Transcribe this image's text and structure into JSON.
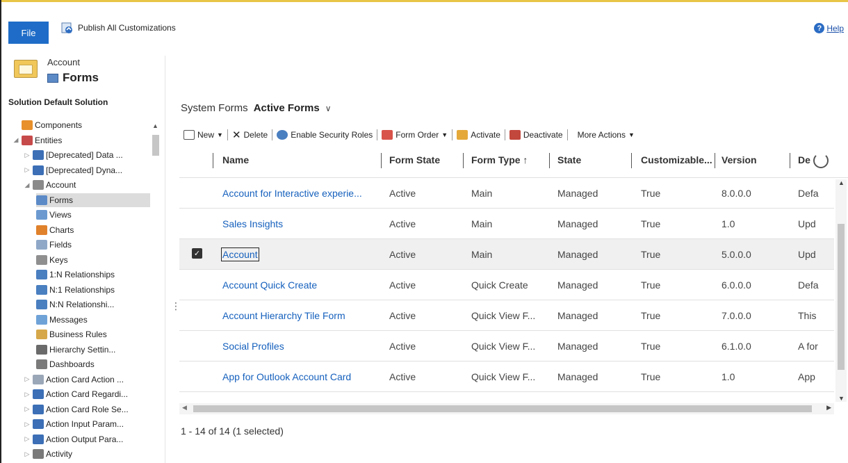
{
  "ribbon": {
    "file_label": "File",
    "publish_label": "Publish All Customizations",
    "help_label": "Help"
  },
  "sidebar": {
    "entity_name": "Account",
    "section_title": "Forms",
    "solution_label": "Solution Default Solution",
    "tree": [
      {
        "label": "Components",
        "depth": 0,
        "twisty": "",
        "icon": "components-icon",
        "color": "#e8902c"
      },
      {
        "label": "Entities",
        "depth": 0,
        "twisty": "◢",
        "icon": "entities-icon",
        "color": "#c74a4a"
      },
      {
        "label": "[Deprecated] Data ...",
        "depth": 1,
        "twisty": "▷",
        "icon": "entity-icon",
        "color": "#3c6fb6"
      },
      {
        "label": "[Deprecated] Dyna...",
        "depth": 1,
        "twisty": "▷",
        "icon": "entity-icon",
        "color": "#3c6fb6"
      },
      {
        "label": "Account",
        "depth": 1,
        "twisty": "◢",
        "icon": "account-icon",
        "color": "#8a8a8a"
      },
      {
        "label": "Forms",
        "depth": 2,
        "twisty": "",
        "icon": "forms-icon",
        "color": "#5c8ac7",
        "selected": true
      },
      {
        "label": "Views",
        "depth": 2,
        "twisty": "",
        "icon": "views-icon",
        "color": "#6c9ad0"
      },
      {
        "label": "Charts",
        "depth": 2,
        "twisty": "",
        "icon": "charts-icon",
        "color": "#e0812c"
      },
      {
        "label": "Fields",
        "depth": 2,
        "twisty": "",
        "icon": "fields-icon",
        "color": "#8fa8c8"
      },
      {
        "label": "Keys",
        "depth": 2,
        "twisty": "",
        "icon": "keys-icon",
        "color": "#8f8f8f"
      },
      {
        "label": "1:N Relationships",
        "depth": 2,
        "twisty": "",
        "icon": "relationship-icon",
        "color": "#4a7fc0"
      },
      {
        "label": "N:1 Relationships",
        "depth": 2,
        "twisty": "",
        "icon": "relationship-icon",
        "color": "#4a7fc0"
      },
      {
        "label": "N:N Relationshi...",
        "depth": 2,
        "twisty": "",
        "icon": "relationship-icon",
        "color": "#4a7fc0"
      },
      {
        "label": "Messages",
        "depth": 2,
        "twisty": "",
        "icon": "messages-icon",
        "color": "#6fa3d8"
      },
      {
        "label": "Business Rules",
        "depth": 2,
        "twisty": "",
        "icon": "business-rules-icon",
        "color": "#d6a84a"
      },
      {
        "label": "Hierarchy Settin...",
        "depth": 2,
        "twisty": "",
        "icon": "hierarchy-icon",
        "color": "#6a6a6a"
      },
      {
        "label": "Dashboards",
        "depth": 2,
        "twisty": "",
        "icon": "dashboards-icon",
        "color": "#7a7a7a"
      },
      {
        "label": "Action Card Action ...",
        "depth": 1,
        "twisty": "▷",
        "icon": "action-card-icon",
        "color": "#9aa7b8"
      },
      {
        "label": "Action Card Regardi...",
        "depth": 1,
        "twisty": "▷",
        "icon": "entity-icon",
        "color": "#3c6fb6"
      },
      {
        "label": "Action Card Role Se...",
        "depth": 1,
        "twisty": "▷",
        "icon": "entity-icon",
        "color": "#3c6fb6"
      },
      {
        "label": "Action Input Param...",
        "depth": 1,
        "twisty": "▷",
        "icon": "entity-icon",
        "color": "#3c6fb6"
      },
      {
        "label": "Action Output Para...",
        "depth": 1,
        "twisty": "▷",
        "icon": "entity-icon",
        "color": "#3c6fb6"
      },
      {
        "label": "Activity",
        "depth": 1,
        "twisty": "▷",
        "icon": "activity-icon",
        "color": "#7a7a7a"
      }
    ]
  },
  "main": {
    "title_prefix": "System Forms",
    "title_view": "Active Forms",
    "title_chevron": "∨",
    "toolbar": {
      "new_label": "New",
      "delete_label": "Delete",
      "security_label": "Enable Security Roles",
      "form_order_label": "Form Order",
      "activate_label": "Activate",
      "deactivate_label": "Deactivate",
      "more_label": "More Actions"
    },
    "columns": [
      "Name",
      "Form State",
      "Form Type ↑",
      "State",
      "Customizable...",
      "Version",
      "De"
    ],
    "rows": [
      {
        "name": "Account for Interactive experie...",
        "form_state": "Active",
        "form_type": "Main",
        "state": "Managed",
        "customizable": "True",
        "version": "8.0.0.0",
        "description": "Defa",
        "selected": false
      },
      {
        "name": "Sales Insights",
        "form_state": "Active",
        "form_type": "Main",
        "state": "Managed",
        "customizable": "True",
        "version": "1.0",
        "description": "Upd",
        "selected": false
      },
      {
        "name": "Account",
        "form_state": "Active",
        "form_type": "Main",
        "state": "Managed",
        "customizable": "True",
        "version": "5.0.0.0",
        "description": "Upd",
        "selected": true
      },
      {
        "name": "Account Quick Create",
        "form_state": "Active",
        "form_type": "Quick Create",
        "state": "Managed",
        "customizable": "True",
        "version": "6.0.0.0",
        "description": "Defa",
        "selected": false
      },
      {
        "name": "Account Hierarchy Tile Form",
        "form_state": "Active",
        "form_type": "Quick View F...",
        "state": "Managed",
        "customizable": "True",
        "version": "7.0.0.0",
        "description": "This",
        "selected": false
      },
      {
        "name": "Social Profiles",
        "form_state": "Active",
        "form_type": "Quick View F...",
        "state": "Managed",
        "customizable": "True",
        "version": "6.1.0.0",
        "description": "A for",
        "selected": false
      },
      {
        "name": "App for Outlook Account Card",
        "form_state": "Active",
        "form_type": "Quick View F...",
        "state": "Managed",
        "customizable": "True",
        "version": "1.0",
        "description": "App",
        "selected": false
      }
    ],
    "record_count": "1 - 14 of 14 (1 selected)"
  }
}
